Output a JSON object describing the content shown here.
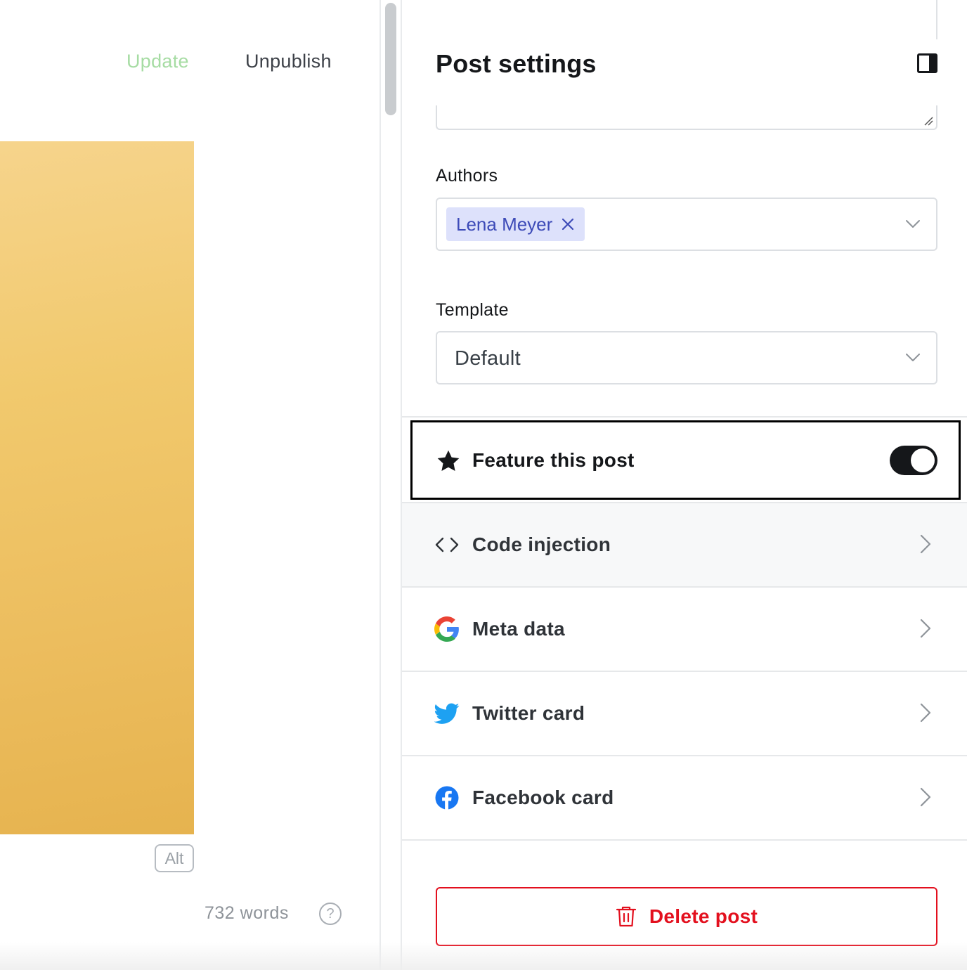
{
  "editor": {
    "update_label": "Update",
    "unpublish_label": "Unpublish",
    "image_alt_badge": "Alt",
    "word_count": "732 words",
    "help_glyph": "?"
  },
  "panel": {
    "title": "Post settings",
    "authors_label": "Authors",
    "authors": [
      "Lena Meyer"
    ],
    "template_label": "Template",
    "template_value": "Default",
    "feature_label": "Feature this post",
    "feature_enabled": true,
    "menu": [
      {
        "label": "Code injection",
        "icon": "code-icon"
      },
      {
        "label": "Meta data",
        "icon": "google-icon"
      },
      {
        "label": "Twitter card",
        "icon": "twitter-icon"
      },
      {
        "label": "Facebook card",
        "icon": "facebook-icon"
      }
    ],
    "delete_label": "Delete post"
  },
  "colors": {
    "accent_green": "#a6dca3",
    "danger": "#e3101e",
    "token_bg": "#dde1fb",
    "token_text": "#3d4bb8",
    "image_gold": "#ecbd5e"
  }
}
